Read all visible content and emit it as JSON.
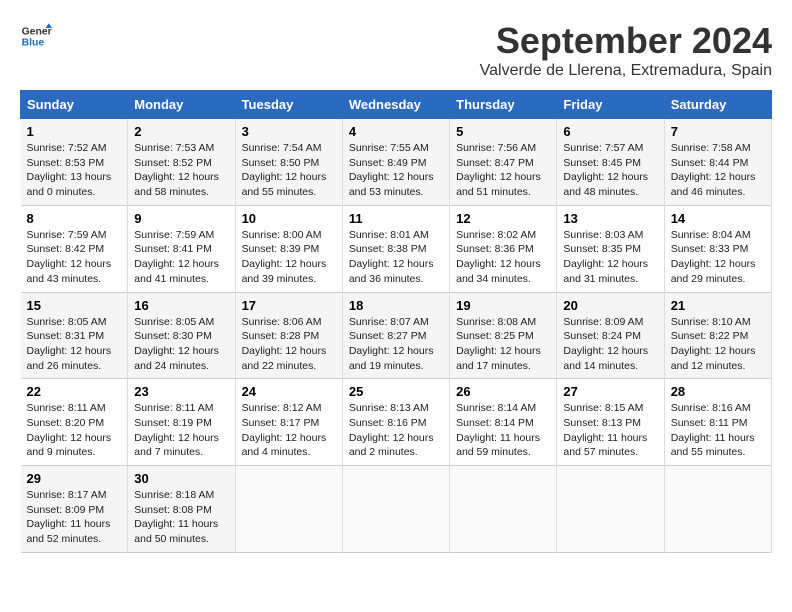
{
  "header": {
    "logo_line1": "General",
    "logo_line2": "Blue",
    "month_year": "September 2024",
    "location": "Valverde de Llerena, Extremadura, Spain"
  },
  "weekdays": [
    "Sunday",
    "Monday",
    "Tuesday",
    "Wednesday",
    "Thursday",
    "Friday",
    "Saturday"
  ],
  "weeks": [
    [
      {
        "day": "1",
        "sunrise": "Sunrise: 7:52 AM",
        "sunset": "Sunset: 8:53 PM",
        "daylight": "Daylight: 13 hours and 0 minutes."
      },
      {
        "day": "2",
        "sunrise": "Sunrise: 7:53 AM",
        "sunset": "Sunset: 8:52 PM",
        "daylight": "Daylight: 12 hours and 58 minutes."
      },
      {
        "day": "3",
        "sunrise": "Sunrise: 7:54 AM",
        "sunset": "Sunset: 8:50 PM",
        "daylight": "Daylight: 12 hours and 55 minutes."
      },
      {
        "day": "4",
        "sunrise": "Sunrise: 7:55 AM",
        "sunset": "Sunset: 8:49 PM",
        "daylight": "Daylight: 12 hours and 53 minutes."
      },
      {
        "day": "5",
        "sunrise": "Sunrise: 7:56 AM",
        "sunset": "Sunset: 8:47 PM",
        "daylight": "Daylight: 12 hours and 51 minutes."
      },
      {
        "day": "6",
        "sunrise": "Sunrise: 7:57 AM",
        "sunset": "Sunset: 8:45 PM",
        "daylight": "Daylight: 12 hours and 48 minutes."
      },
      {
        "day": "7",
        "sunrise": "Sunrise: 7:58 AM",
        "sunset": "Sunset: 8:44 PM",
        "daylight": "Daylight: 12 hours and 46 minutes."
      }
    ],
    [
      {
        "day": "8",
        "sunrise": "Sunrise: 7:59 AM",
        "sunset": "Sunset: 8:42 PM",
        "daylight": "Daylight: 12 hours and 43 minutes."
      },
      {
        "day": "9",
        "sunrise": "Sunrise: 7:59 AM",
        "sunset": "Sunset: 8:41 PM",
        "daylight": "Daylight: 12 hours and 41 minutes."
      },
      {
        "day": "10",
        "sunrise": "Sunrise: 8:00 AM",
        "sunset": "Sunset: 8:39 PM",
        "daylight": "Daylight: 12 hours and 39 minutes."
      },
      {
        "day": "11",
        "sunrise": "Sunrise: 8:01 AM",
        "sunset": "Sunset: 8:38 PM",
        "daylight": "Daylight: 12 hours and 36 minutes."
      },
      {
        "day": "12",
        "sunrise": "Sunrise: 8:02 AM",
        "sunset": "Sunset: 8:36 PM",
        "daylight": "Daylight: 12 hours and 34 minutes."
      },
      {
        "day": "13",
        "sunrise": "Sunrise: 8:03 AM",
        "sunset": "Sunset: 8:35 PM",
        "daylight": "Daylight: 12 hours and 31 minutes."
      },
      {
        "day": "14",
        "sunrise": "Sunrise: 8:04 AM",
        "sunset": "Sunset: 8:33 PM",
        "daylight": "Daylight: 12 hours and 29 minutes."
      }
    ],
    [
      {
        "day": "15",
        "sunrise": "Sunrise: 8:05 AM",
        "sunset": "Sunset: 8:31 PM",
        "daylight": "Daylight: 12 hours and 26 minutes."
      },
      {
        "day": "16",
        "sunrise": "Sunrise: 8:05 AM",
        "sunset": "Sunset: 8:30 PM",
        "daylight": "Daylight: 12 hours and 24 minutes."
      },
      {
        "day": "17",
        "sunrise": "Sunrise: 8:06 AM",
        "sunset": "Sunset: 8:28 PM",
        "daylight": "Daylight: 12 hours and 22 minutes."
      },
      {
        "day": "18",
        "sunrise": "Sunrise: 8:07 AM",
        "sunset": "Sunset: 8:27 PM",
        "daylight": "Daylight: 12 hours and 19 minutes."
      },
      {
        "day": "19",
        "sunrise": "Sunrise: 8:08 AM",
        "sunset": "Sunset: 8:25 PM",
        "daylight": "Daylight: 12 hours and 17 minutes."
      },
      {
        "day": "20",
        "sunrise": "Sunrise: 8:09 AM",
        "sunset": "Sunset: 8:24 PM",
        "daylight": "Daylight: 12 hours and 14 minutes."
      },
      {
        "day": "21",
        "sunrise": "Sunrise: 8:10 AM",
        "sunset": "Sunset: 8:22 PM",
        "daylight": "Daylight: 12 hours and 12 minutes."
      }
    ],
    [
      {
        "day": "22",
        "sunrise": "Sunrise: 8:11 AM",
        "sunset": "Sunset: 8:20 PM",
        "daylight": "Daylight: 12 hours and 9 minutes."
      },
      {
        "day": "23",
        "sunrise": "Sunrise: 8:11 AM",
        "sunset": "Sunset: 8:19 PM",
        "daylight": "Daylight: 12 hours and 7 minutes."
      },
      {
        "day": "24",
        "sunrise": "Sunrise: 8:12 AM",
        "sunset": "Sunset: 8:17 PM",
        "daylight": "Daylight: 12 hours and 4 minutes."
      },
      {
        "day": "25",
        "sunrise": "Sunrise: 8:13 AM",
        "sunset": "Sunset: 8:16 PM",
        "daylight": "Daylight: 12 hours and 2 minutes."
      },
      {
        "day": "26",
        "sunrise": "Sunrise: 8:14 AM",
        "sunset": "Sunset: 8:14 PM",
        "daylight": "Daylight: 11 hours and 59 minutes."
      },
      {
        "day": "27",
        "sunrise": "Sunrise: 8:15 AM",
        "sunset": "Sunset: 8:13 PM",
        "daylight": "Daylight: 11 hours and 57 minutes."
      },
      {
        "day": "28",
        "sunrise": "Sunrise: 8:16 AM",
        "sunset": "Sunset: 8:11 PM",
        "daylight": "Daylight: 11 hours and 55 minutes."
      }
    ],
    [
      {
        "day": "29",
        "sunrise": "Sunrise: 8:17 AM",
        "sunset": "Sunset: 8:09 PM",
        "daylight": "Daylight: 11 hours and 52 minutes."
      },
      {
        "day": "30",
        "sunrise": "Sunrise: 8:18 AM",
        "sunset": "Sunset: 8:08 PM",
        "daylight": "Daylight: 11 hours and 50 minutes."
      },
      null,
      null,
      null,
      null,
      null
    ]
  ]
}
